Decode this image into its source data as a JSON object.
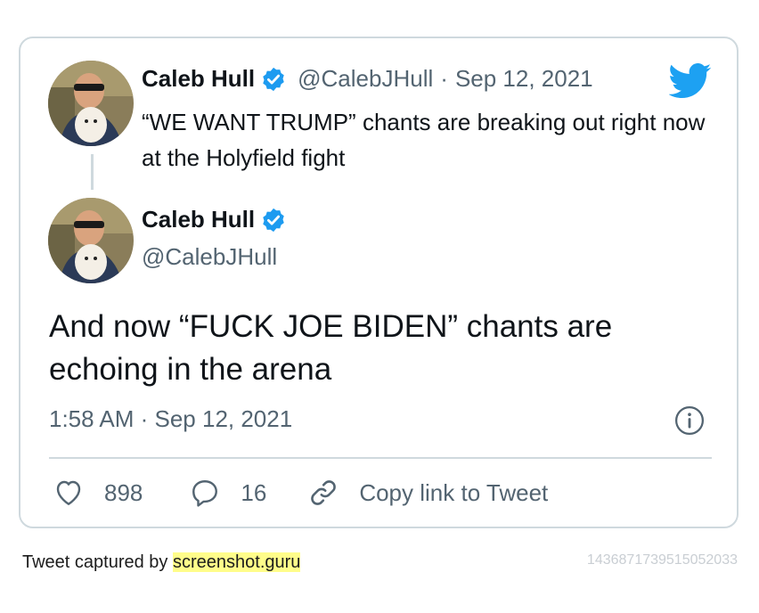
{
  "quoted_tweet": {
    "display_name": "Caleb Hull",
    "handle": "@CalebJHull",
    "separator": "·",
    "date": "Sep 12, 2021",
    "text": "“WE WANT TRUMP” chants are breaking out right now at the Holyfield fight"
  },
  "main_tweet": {
    "display_name": "Caleb Hull",
    "handle": "@CalebJHull",
    "text": "And now “FUCK JOE BIDEN” chants are echoing in the arena",
    "timestamp": "1:58 AM · Sep 12, 2021"
  },
  "actions": {
    "likes": "898",
    "replies": "16",
    "copy_link_label": "Copy link to Tweet"
  },
  "footer": {
    "captured_by_label": "Tweet captured by ",
    "site_label": "screenshot.guru",
    "tweet_id": "1436871739515052033"
  },
  "colors": {
    "verified_blue": "#1d9bf0",
    "text_secondary": "#536471",
    "border": "#cfd9de",
    "twitter_blue": "#1da1f2"
  },
  "icons": [
    "verified-badge-icon",
    "twitter-bird-icon",
    "info-icon",
    "heart-icon",
    "reply-icon",
    "link-icon"
  ]
}
